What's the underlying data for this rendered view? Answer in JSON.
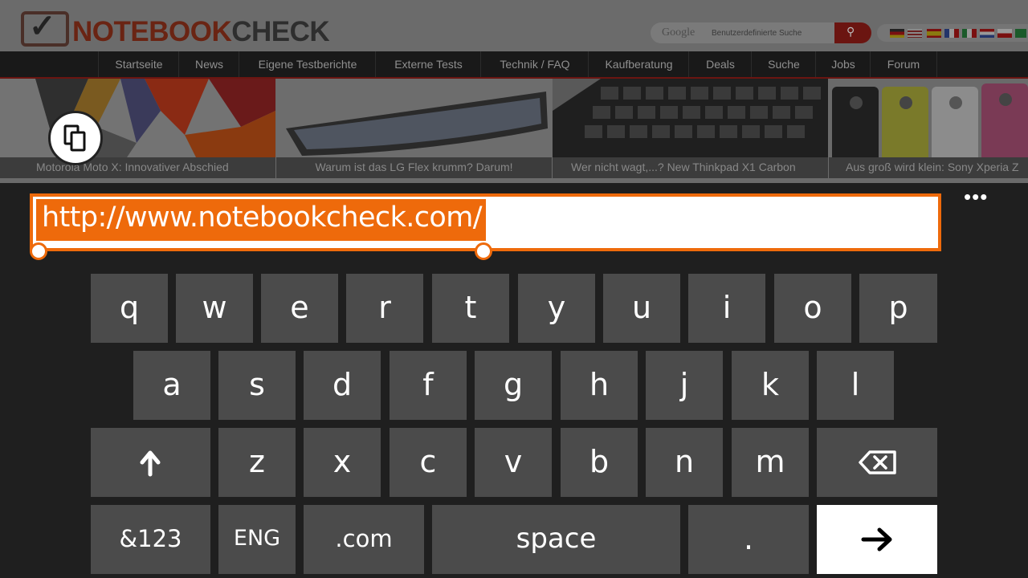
{
  "website": {
    "logo_prefix": "NOTEBOOK",
    "logo_suffix": "CHECK",
    "search_brand": "Google",
    "search_placeholder": "Benutzerdefinierte Suche",
    "nav_items": [
      "Startseite",
      "News",
      "Eigene Testberichte",
      "Externe Tests",
      "Technik / FAQ",
      "Kaufberatung",
      "Deals",
      "Suche",
      "Jobs",
      "Forum"
    ],
    "tiles": [
      {
        "caption": "Motorola Moto X: Innovativer Abschied"
      },
      {
        "caption": "Warum ist das LG Flex krumm? Darum!"
      },
      {
        "caption": "Wer nicht wagt,...? New Thinkpad X1 Carbon"
      },
      {
        "caption": "Aus groß wird klein: Sony Xperia Z"
      }
    ]
  },
  "address_bar": {
    "url": "http://www.notebookcheck.com/",
    "more_label": "•••",
    "accent_color": "#ee6a0b"
  },
  "keyboard": {
    "row1": [
      "q",
      "w",
      "e",
      "r",
      "t",
      "y",
      "u",
      "i",
      "o",
      "p"
    ],
    "row2": [
      "a",
      "s",
      "d",
      "f",
      "g",
      "h",
      "j",
      "k",
      "l"
    ],
    "row3": [
      "z",
      "x",
      "c",
      "v",
      "b",
      "n",
      "m"
    ],
    "symbols_label": "&123",
    "language_label": "ENG",
    "dotcom_label": ".com",
    "space_label": "space",
    "period_label": ".",
    "shift_icon": "arrow-up-icon",
    "backspace_icon": "backspace-icon",
    "enter_icon": "arrow-right-icon"
  }
}
